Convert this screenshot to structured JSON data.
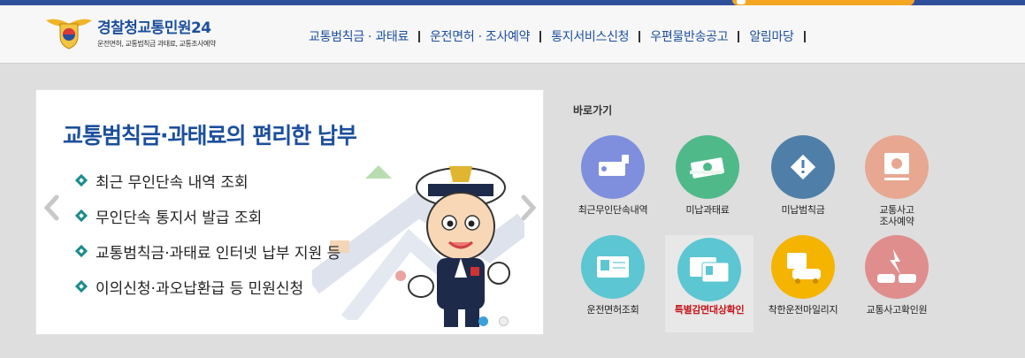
{
  "header": {
    "logo_title_main": "경찰청",
    "logo_title_accent": "교통민원24",
    "logo_subtitle": "운전면허, 교통범칙금 과태료, 교통조사예약"
  },
  "gnb": [
    {
      "label": "교통범칙금 · 과태료"
    },
    {
      "label": "운전면허 · 조사예약"
    },
    {
      "label": "통지서비스신청"
    },
    {
      "label": "우편물반송공고"
    },
    {
      "label": "알림마당"
    }
  ],
  "slider": {
    "title": "교통범칙금·과태료의 편리한 납부",
    "items": [
      "최근 무인단속 내역 조회",
      "무인단속 통지서 발급 조회",
      "교통범칙금·과태료 인터넷 납부 지원 등",
      "이의신청·과오납환급 등 민원신청"
    ],
    "current_page": 1,
    "total_pages": 2
  },
  "quick": {
    "title": "바로가기",
    "items": [
      {
        "label": "최근무인단속내역",
        "color": "#7f8fde",
        "icon": "camera-icon"
      },
      {
        "label": "미납과태료",
        "color": "#4fb98a",
        "icon": "money-icon"
      },
      {
        "label": "미납범칙금",
        "color": "#4f7fa8",
        "icon": "warning-icon"
      },
      {
        "label": "교통사고\n조사예약",
        "color": "#e7a791",
        "icon": "monitor-icon"
      },
      {
        "label": "운전면허조회",
        "color": "#5cc6d2",
        "icon": "license-card-icon"
      },
      {
        "label": "특별감면대상확인",
        "color": "#5cc6d2",
        "icon": "documents-icon",
        "highlight": "#c4161c"
      },
      {
        "label": "착한운전마일리지",
        "color": "#f4b400",
        "icon": "mileage-car-icon"
      },
      {
        "label": "교통사고확인원",
        "color": "#e08d8d",
        "icon": "crash-icon"
      }
    ]
  },
  "colors": {
    "brand_blue": "#1c4f9c",
    "topbar": "#2f4f9a",
    "top_accent": "#f5a623",
    "bullet": "#1a8b8b",
    "dot_active": "#3b9fd8"
  }
}
